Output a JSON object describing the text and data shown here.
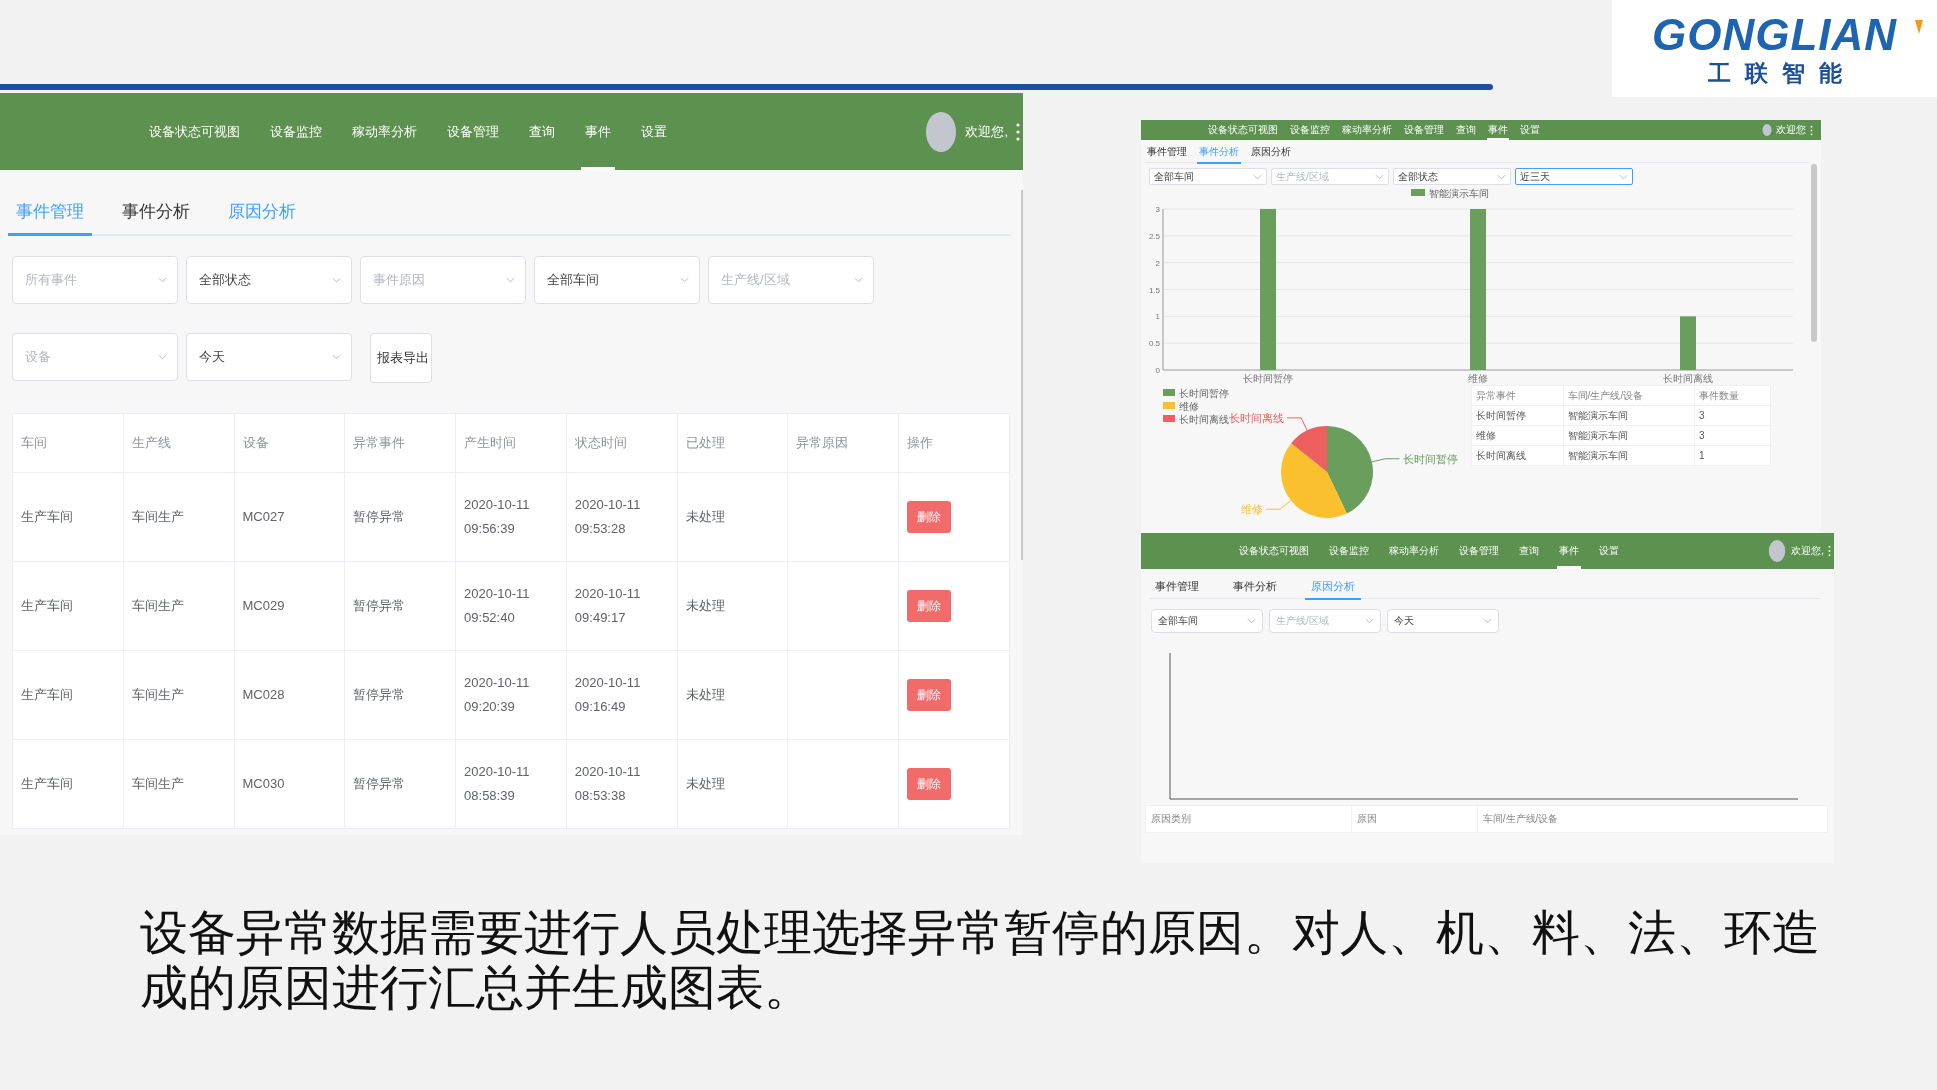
{
  "logo": {
    "wordmark": "GONGLIAN",
    "tagline": "工联智能"
  },
  "event_management_screen": {
    "nav": {
      "items": [
        {
          "label": "设备状态可视图",
          "selected": false
        },
        {
          "label": "设备监控",
          "selected": false
        },
        {
          "label": "稼动率分析",
          "selected": false
        },
        {
          "label": "设备管理",
          "selected": false
        },
        {
          "label": "查询",
          "selected": false
        },
        {
          "label": "事件",
          "selected": true
        },
        {
          "label": "设置",
          "selected": false
        }
      ],
      "welcome": "欢迎您,"
    },
    "tabs": [
      {
        "label": "事件管理",
        "selected": true,
        "hovered": false
      },
      {
        "label": "事件分析",
        "selected": false,
        "hovered": false
      },
      {
        "label": "原因分析",
        "selected": false,
        "hovered": true
      }
    ],
    "filters": [
      {
        "placeholder": "所有事件"
      },
      {
        "value": "全部状态"
      },
      {
        "placeholder": "事件原因"
      },
      {
        "value": "全部车间"
      },
      {
        "placeholder": "生产线/区域"
      },
      {
        "placeholder": "设备"
      },
      {
        "value": "今天"
      }
    ],
    "export_button": "报表导出",
    "table": {
      "columns": [
        "车间",
        "生产线",
        "设备",
        "异常事件",
        "产生时间",
        "状态时间",
        "已处理",
        "异常原因",
        "操作"
      ],
      "rows": [
        {
          "workshop": "生产车间",
          "line": "车间生产",
          "device": "MC027",
          "event": "暂停异常",
          "created": "2020-10-11 09:56:39",
          "status_time": "2020-10-11 09:53:28",
          "handled": "未处理",
          "action": "删除"
        },
        {
          "workshop": "生产车间",
          "line": "车间生产",
          "device": "MC029",
          "event": "暂停异常",
          "created": "2020-10-11 09:52:40",
          "status_time": "2020-10-11 09:49:17",
          "handled": "未处理",
          "action": "删除"
        },
        {
          "workshop": "生产车间",
          "line": "车间生产",
          "device": "MC028",
          "event": "暂停异常",
          "created": "2020-10-11 09:20:39",
          "status_time": "2020-10-11 09:16:49",
          "handled": "未处理",
          "action": "删除"
        },
        {
          "workshop": "生产车间",
          "line": "车间生产",
          "device": "MC030",
          "event": "暂停异常",
          "created": "2020-10-11 08:58:39",
          "status_time": "2020-10-11 08:53:38",
          "handled": "未处理",
          "action": "删除"
        }
      ]
    }
  },
  "event_analysis_screen": {
    "nav": {
      "items": [
        {
          "label": "设备状态可视图",
          "selected": false
        },
        {
          "label": "设备监控",
          "selected": false
        },
        {
          "label": "稼动率分析",
          "selected": false
        },
        {
          "label": "设备管理",
          "selected": false
        },
        {
          "label": "查询",
          "selected": false
        },
        {
          "label": "事件",
          "selected": true
        },
        {
          "label": "设置",
          "selected": false
        }
      ],
      "welcome": "欢迎您"
    },
    "tabs": [
      {
        "label": "事件管理",
        "selected": false
      },
      {
        "label": "事件分析",
        "selected": true
      },
      {
        "label": "原因分析",
        "selected": false
      }
    ],
    "filters": [
      {
        "value": "全部车间",
        "focused": false
      },
      {
        "placeholder": "生产线/区域",
        "focused": false
      },
      {
        "value": "全部状态",
        "focused": false
      },
      {
        "value": "近三天",
        "focused": true
      }
    ],
    "bar_chart": {
      "chart_data": {
        "type": "bar",
        "categories": [
          "长时间暂停",
          "维修",
          "长时间离线"
        ],
        "series": [
          {
            "name": "智能演示车间",
            "color": "#6a9e5c",
            "values": [
              3,
              3,
              1
            ]
          }
        ],
        "ylim": [
          0,
          3
        ],
        "grid": true,
        "yticks": [
          0,
          0.5,
          1,
          1.5,
          2,
          2.5,
          3
        ]
      }
    },
    "pie_chart": {
      "legend": [
        "长时间暂停",
        "维修",
        "长时间离线"
      ],
      "chart_data": {
        "type": "pie",
        "categories": [
          "长时间暂停",
          "维修",
          "长时间离线"
        ],
        "values": [
          42.9,
          42.9,
          14.2
        ],
        "colors": [
          "#6a9e5c",
          "#fbc02d",
          "#ee6060"
        ]
      }
    },
    "summary_table": {
      "columns": [
        "异常事件",
        "车间/生产线/设备",
        "事件数量"
      ],
      "rows": [
        [
          "长时间暂停",
          "智能演示车间",
          "3"
        ],
        [
          "维修",
          "智能演示车间",
          "3"
        ],
        [
          "长时间离线",
          "智能演示车间",
          "1"
        ]
      ]
    }
  },
  "cause_analysis_screen": {
    "nav": {
      "items": [
        {
          "label": "设备状态可视图",
          "selected": false
        },
        {
          "label": "设备监控",
          "selected": false
        },
        {
          "label": "稼动率分析",
          "selected": false
        },
        {
          "label": "设备管理",
          "selected": false
        },
        {
          "label": "查询",
          "selected": false
        },
        {
          "label": "事件",
          "selected": true
        },
        {
          "label": "设置",
          "selected": false
        }
      ],
      "welcome": "欢迎您,"
    },
    "tabs": [
      {
        "label": "事件管理",
        "selected": false
      },
      {
        "label": "事件分析",
        "selected": false
      },
      {
        "label": "原因分析",
        "selected": true
      }
    ],
    "filters": [
      {
        "value": "全部车间"
      },
      {
        "placeholder": "生产线/区域"
      },
      {
        "value": "今天"
      }
    ],
    "table": {
      "columns": [
        "原因类别",
        "原因",
        "车间/生产线/设备"
      ]
    }
  },
  "caption": "设备异常数据需要进行人员处理选择异常暂停的原因。对人、机、料、法、环造成的原因进行汇总并生成图表。"
}
